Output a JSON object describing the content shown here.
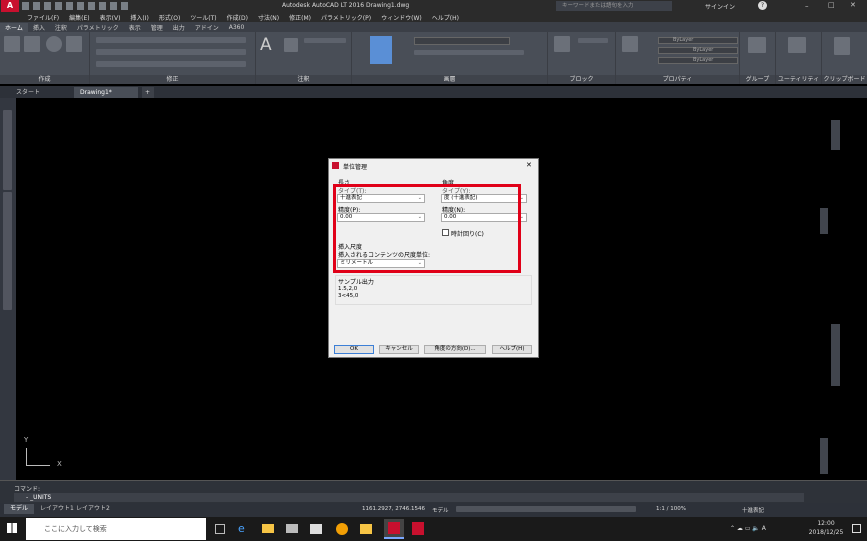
{
  "window": {
    "title": "Autodesk AutoCAD LT 2016    Drawing1.dwg",
    "search_placeholder": "キーワードまたは語句を入力",
    "signin": "サインイン"
  },
  "menu": [
    "ファイル(F)",
    "編集(E)",
    "表示(V)",
    "挿入(I)",
    "形式(O)",
    "ツール(T)",
    "作成(D)",
    "寸法(N)",
    "修正(M)",
    "パラメトリック(P)",
    "ウィンドウ(W)",
    "ヘルプ(H)"
  ],
  "ribbon_tabs": [
    "ホーム",
    "挿入",
    "注釈",
    "パラメトリック",
    "表示",
    "管理",
    "出力",
    "アドイン",
    "A360"
  ],
  "ribbon_panels": [
    "作成",
    "修正",
    "注釈",
    "画層",
    "ブロック",
    "プロパティ",
    "グループ",
    "ユーティリティ",
    "クリップボード"
  ],
  "ribbon_layer": {
    "bylayer_1": "ByLayer",
    "bylayer_2": "ByLayer",
    "bylayer_3": "ByLayer"
  },
  "doc_tabs": [
    "スタート",
    "Drawing1*"
  ],
  "dialog": {
    "title": "単位管理",
    "length_heading": "長さ",
    "length_type_label": "タイプ(T):",
    "length_type_value": "十進表記",
    "length_precision_label": "精度(P):",
    "length_precision_value": "0.00",
    "angle_heading": "角度",
    "angle_type_label": "タイプ(Y):",
    "angle_type_value": "度 (十進表記)",
    "angle_precision_label": "精度(N):",
    "angle_precision_value": "0.00",
    "clockwise_label": "時計回り(C)",
    "insert_scale_heading": "挿入尺度",
    "insert_scale_label": "挿入されるコンテンツの尺度単位:",
    "insert_scale_value": "ミリメートル",
    "sample_heading": "サンプル出力",
    "sample_line1": "1.5,2,0",
    "sample_line2": "3<45,0",
    "ok": "OK",
    "cancel": "キャンセル",
    "direction": "角度の方向(D)...",
    "help": "ヘルプ(H)"
  },
  "command": {
    "history": "コマンド:",
    "current": "- _UNITS"
  },
  "layout_tabs": [
    "モデル",
    "レイアウト1",
    "レイアウト2"
  ],
  "status": {
    "coords": "1161.2927, 2746.1546",
    "model": "モデル",
    "scale": "1:1 / 100%",
    "units": "十進表記"
  },
  "taskbar": {
    "search_placeholder": "ここに入力して検索",
    "time": "12:00",
    "date": "2018/12/25"
  }
}
